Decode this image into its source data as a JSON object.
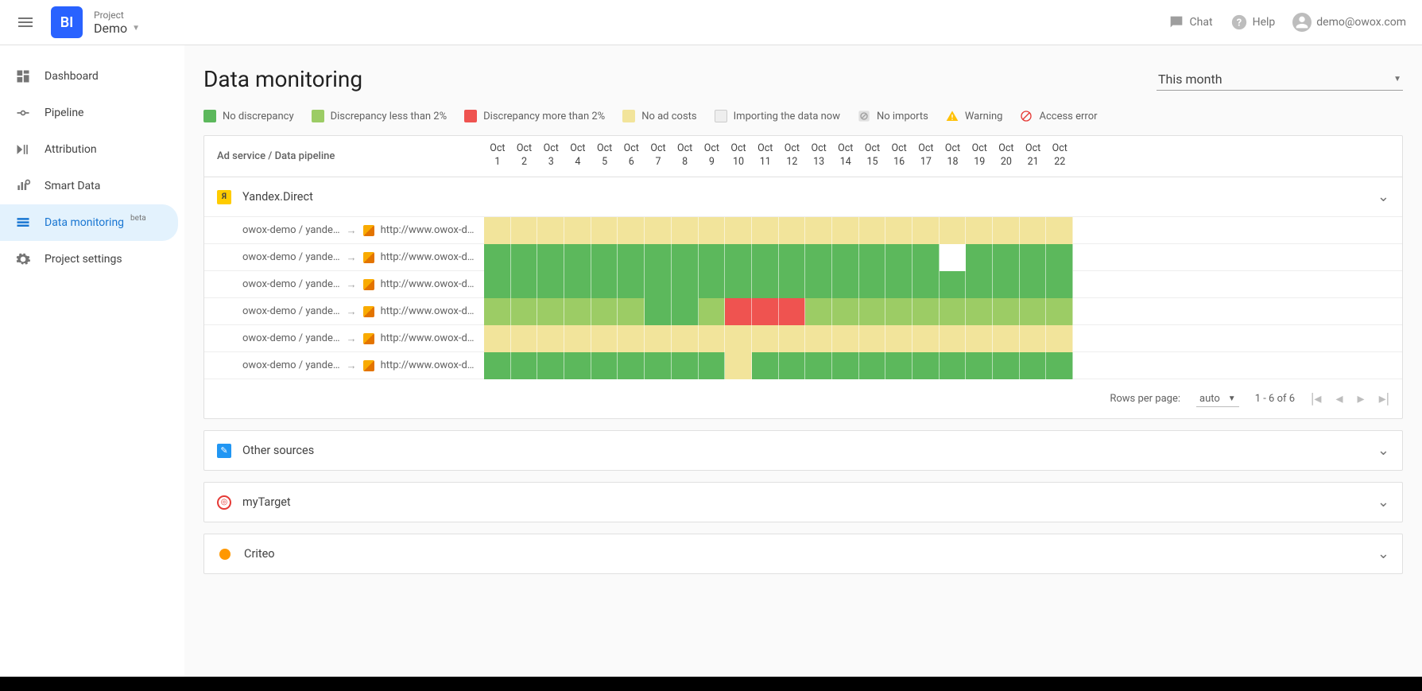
{
  "header": {
    "project_label": "Project",
    "project_name": "Demo",
    "chat": "Chat",
    "help": "Help",
    "user_email": "demo@owox.com"
  },
  "sidebar": {
    "items": [
      {
        "label": "Dashboard"
      },
      {
        "label": "Pipeline"
      },
      {
        "label": "Attribution"
      },
      {
        "label": "Smart Data"
      },
      {
        "label": "Data monitoring",
        "badge": "beta"
      },
      {
        "label": "Project settings"
      }
    ]
  },
  "page": {
    "title": "Data monitoring",
    "period": "This month"
  },
  "legend": [
    {
      "label": "No discrepancy",
      "color": "#5cb85c"
    },
    {
      "label": "Discrepancy less than 2%",
      "color": "#9ccc65"
    },
    {
      "label": "Discrepancy more than 2%",
      "color": "#ef5350"
    },
    {
      "label": "No ad costs",
      "color": "#f2e49b"
    },
    {
      "label": "Importing the data now",
      "color": "#eeeeee"
    },
    {
      "label": "No imports",
      "icon": "noimport"
    },
    {
      "label": "Warning",
      "icon": "warning"
    },
    {
      "label": "Access error",
      "icon": "error"
    }
  ],
  "table": {
    "column_label": "Ad service / Data pipeline",
    "dates": [
      "Oct 1",
      "Oct 2",
      "Oct 3",
      "Oct 4",
      "Oct 5",
      "Oct 6",
      "Oct 7",
      "Oct 8",
      "Oct 9",
      "Oct 10",
      "Oct 11",
      "Oct 12",
      "Oct 13",
      "Oct 14",
      "Oct 15",
      "Oct 16",
      "Oct 17",
      "Oct 18",
      "Oct 19",
      "Oct 20",
      "Oct 21",
      "Oct 22"
    ],
    "groups": [
      {
        "name": "Yandex.Direct",
        "icon": "yandex"
      }
    ],
    "rows": [
      {
        "source": "owox-demo / yande…",
        "dest": "http://www.owox-d…",
        "cells": [
          "y",
          "y",
          "y",
          "y",
          "y",
          "y",
          "y",
          "y",
          "y",
          "y",
          "y",
          "y",
          "y",
          "y",
          "y",
          "y",
          "y",
          "y",
          "y",
          "y",
          "y",
          "y"
        ]
      },
      {
        "source": "owox-demo / yande…",
        "dest": "http://www.owox-d…",
        "cells": [
          "g",
          "g",
          "g",
          "g",
          "g",
          "g",
          "g",
          "g",
          "g",
          "g",
          "g",
          "g",
          "g",
          "g",
          "g",
          "g",
          "g",
          "w",
          "g",
          "g",
          "g",
          "g"
        ]
      },
      {
        "source": "owox-demo / yande…",
        "dest": "http://www.owox-d…",
        "cells": [
          "g",
          "g",
          "g",
          "g",
          "g",
          "g",
          "g",
          "g",
          "g",
          "g",
          "g",
          "g",
          "g",
          "g",
          "g",
          "g",
          "g",
          "g",
          "g",
          "g",
          "g",
          "g"
        ]
      },
      {
        "source": "owox-demo / yande…",
        "dest": "http://www.owox-d…",
        "cells": [
          "l",
          "l",
          "l",
          "l",
          "l",
          "l",
          "g",
          "g",
          "l",
          "r",
          "r",
          "r",
          "l",
          "l",
          "l",
          "l",
          "l",
          "l",
          "l",
          "l",
          "l",
          "l"
        ]
      },
      {
        "source": "owox-demo / yande…",
        "dest": "http://www.owox-d…",
        "cells": [
          "y",
          "y",
          "y",
          "y",
          "y",
          "y",
          "y",
          "y",
          "y",
          "y",
          "y",
          "y",
          "y",
          "y",
          "y",
          "y",
          "y",
          "y",
          "y",
          "y",
          "y",
          "y"
        ]
      },
      {
        "source": "owox-demo / yande…",
        "dest": "http://www.owox-d…",
        "cells": [
          "g",
          "g",
          "g",
          "g",
          "g",
          "g",
          "g",
          "g",
          "g",
          "y",
          "g",
          "g",
          "g",
          "g",
          "g",
          "g",
          "g",
          "g",
          "g",
          "g",
          "g",
          "g"
        ]
      }
    ],
    "colors": {
      "g": "#5cb85c",
      "l": "#9ccc65",
      "r": "#ef5350",
      "y": "#f2e49b",
      "w": "#ffffff"
    },
    "footer": {
      "rpp_label": "Rows per page:",
      "rpp_value": "auto",
      "range": "1 - 6  of 6"
    }
  },
  "other_groups": [
    {
      "name": "Other sources",
      "icon": "other"
    },
    {
      "name": "myTarget",
      "icon": "mytarget"
    },
    {
      "name": "Criteo",
      "icon": "criteo"
    }
  ]
}
